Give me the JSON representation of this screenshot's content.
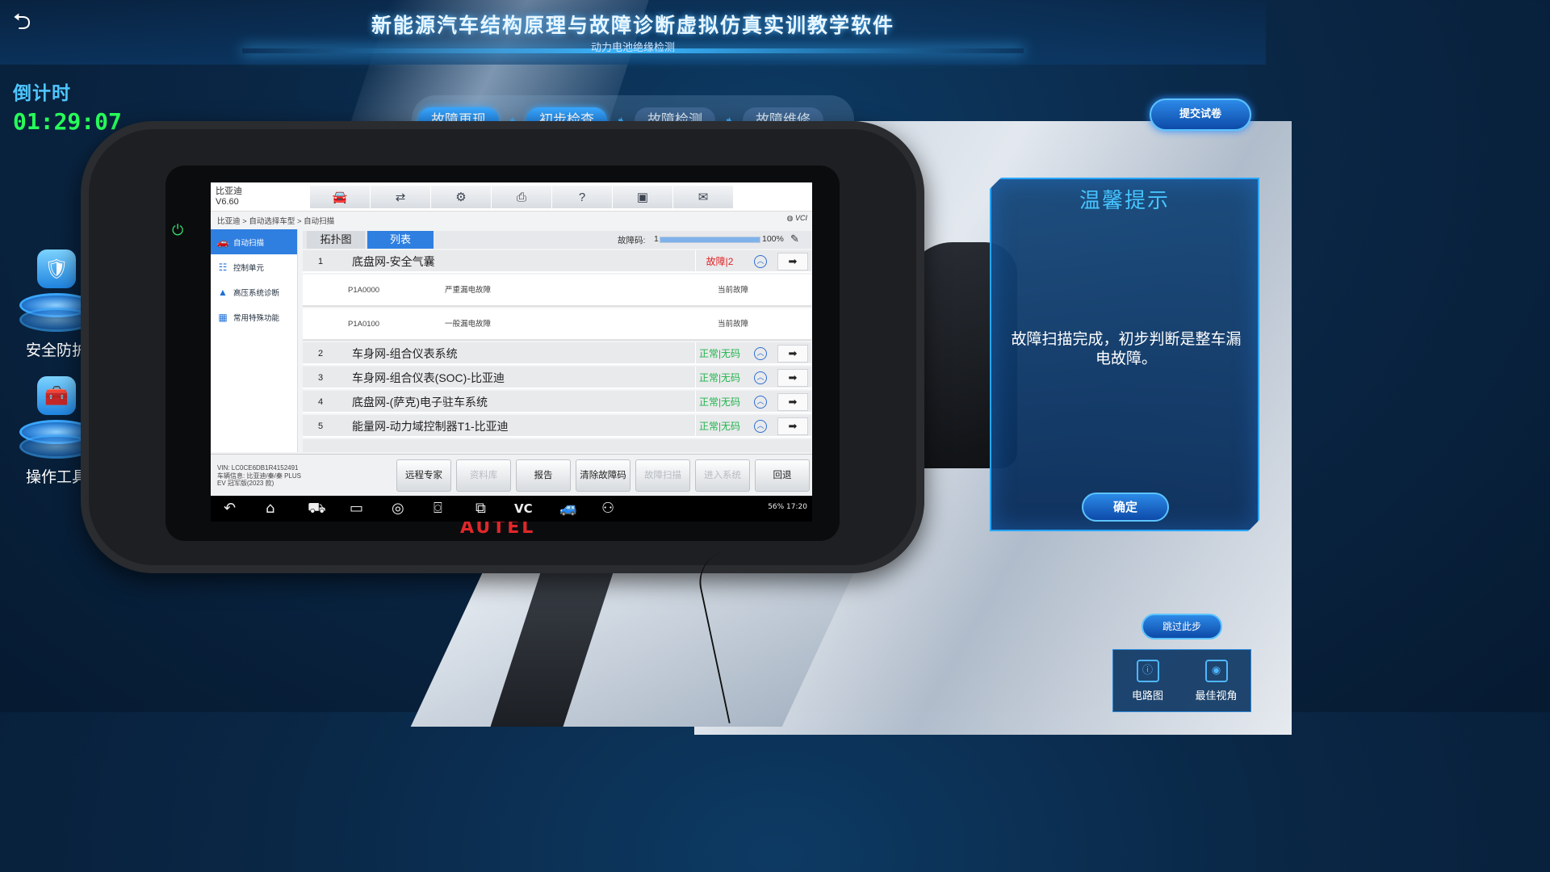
{
  "header": {
    "title": "新能源汽车结构原理与故障诊断虚拟仿真实训教学软件",
    "subtitle": "动力电池绝缘检测"
  },
  "countdown": {
    "label": "倒计时",
    "value": "01:29:07"
  },
  "steps": [
    {
      "label": "故障再现"
    },
    {
      "label": "初步检查"
    },
    {
      "label": "故障检测"
    },
    {
      "label": "故障维修"
    }
  ],
  "submit_label": "提交试卷",
  "left_tools": [
    {
      "label": "安全防护",
      "icon": "shield-helmet-icon"
    },
    {
      "label": "操作工具",
      "icon": "toolbox-icon"
    }
  ],
  "tablet": {
    "brand": "AUTEL",
    "screen": {
      "vehicle": "比亚迪",
      "version": "V6.60",
      "breadcrumb": "比亚迪 > 自动选择车型 > 自动扫描",
      "status_vci": "VCI",
      "sidebar": [
        {
          "label": "自动扫描",
          "icon": "car-scan-icon"
        },
        {
          "label": "控制单元",
          "icon": "control-unit-icon"
        },
        {
          "label": "高压系统诊断",
          "icon": "warning-triangle-icon"
        },
        {
          "label": "常用特殊功能",
          "icon": "special-function-icon"
        }
      ],
      "tabs": [
        {
          "label": "拓扑图"
        },
        {
          "label": "列表"
        }
      ],
      "fault_code_label": "故障码:",
      "fault_code_count": "1",
      "progress_percent": 100,
      "progress_text": "100%",
      "rows": [
        {
          "num": "1",
          "name": "底盘网-安全气囊",
          "status": "故障|2",
          "status_type": "err"
        },
        {
          "num": "2",
          "name": "车身网-组合仪表系统",
          "status": "正常|无码",
          "status_type": "ok"
        },
        {
          "num": "3",
          "name": "车身网-组合仪表(SOC)-比亚迪",
          "status": "正常|无码",
          "status_type": "ok"
        },
        {
          "num": "4",
          "name": "底盘网-(萨克)电子驻车系统",
          "status": "正常|无码",
          "status_type": "ok"
        },
        {
          "num": "5",
          "name": "能量网-动力域控制器T1-比亚迪",
          "status": "正常|无码",
          "status_type": "ok"
        }
      ],
      "dtcs": [
        {
          "code": "P1A0000",
          "desc": "严重漏电故障",
          "state": "当前故障"
        },
        {
          "code": "P1A0100",
          "desc": "一般漏电故障",
          "state": "当前故障"
        }
      ],
      "vin": "VIN: LC0CE6DB1R4152491",
      "vehicle_info": "车辆信息: 比亚迪/秦/秦 PLUS",
      "vehicle_info2": "EV 冠军版(2023 款)",
      "buttons": [
        {
          "label": "远程专家",
          "enabled": true
        },
        {
          "label": "资料库",
          "enabled": false
        },
        {
          "label": "报告",
          "enabled": true
        },
        {
          "label": "清除故障码",
          "enabled": true
        },
        {
          "label": "故障扫描",
          "enabled": false
        },
        {
          "label": "进入系统",
          "enabled": false
        },
        {
          "label": "回退",
          "enabled": true
        }
      ],
      "nav_status": "56% 17:20"
    }
  },
  "tip": {
    "title": "温馨提示",
    "message": "故障扫描完成，初步判断是整车漏电故障。",
    "ok_label": "确定"
  },
  "skip_label": "跳过此步",
  "dock": [
    {
      "label": "电路图",
      "icon": "circuit-diagram-icon"
    },
    {
      "label": "最佳视角",
      "icon": "eye-view-icon"
    }
  ],
  "colors": {
    "accent": "#2f7fe0",
    "countdown": "#28ff5a",
    "error": "#e02424",
    "ok": "#1fb44a"
  }
}
